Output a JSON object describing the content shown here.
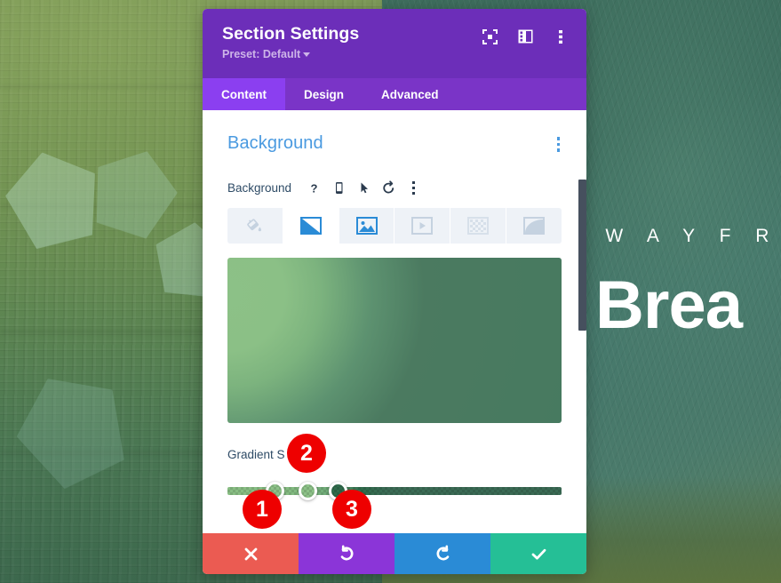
{
  "page_background": {
    "hero_kicker": "E  A W A Y   F R O M",
    "hero_title": "& Brea",
    "note": "website preview behind the settings modal"
  },
  "modal": {
    "title": "Section Settings",
    "preset_label": "Preset: Default",
    "header_icons": [
      {
        "name": "expand-focus-icon",
        "label": "Focus"
      },
      {
        "name": "layout-panel-icon",
        "label": "Panel layout"
      },
      {
        "name": "more-options-icon",
        "label": "More options"
      }
    ],
    "tabs": [
      {
        "label": "Content",
        "active": true
      },
      {
        "label": "Design",
        "active": false
      },
      {
        "label": "Advanced",
        "active": false
      }
    ],
    "section": {
      "title": "Background",
      "options_icon": "more-options-icon"
    },
    "control_row": {
      "label": "Background",
      "buttons": [
        {
          "name": "help-icon",
          "glyph": "?"
        },
        {
          "name": "responsive-mobile-icon",
          "glyph": "mobile"
        },
        {
          "name": "hover-cursor-icon",
          "glyph": "cursor"
        },
        {
          "name": "reset-icon",
          "glyph": "undo-arrow"
        },
        {
          "name": "more-options-icon",
          "glyph": "ellipsis"
        }
      ]
    },
    "background_types": [
      {
        "name": "background-color",
        "label": "Background Color",
        "active": false
      },
      {
        "name": "background-gradient",
        "label": "Background Gradient",
        "active": true
      },
      {
        "name": "background-image",
        "label": "Background Image",
        "active": false
      },
      {
        "name": "background-video",
        "label": "Background Video",
        "active": false
      },
      {
        "name": "background-pattern",
        "label": "Background Pattern",
        "active": false
      },
      {
        "name": "background-mask",
        "label": "Background Mask",
        "active": false
      }
    ],
    "gradient_preview": {
      "type": "radial",
      "colors": [
        "#8cc187",
        "#477a60"
      ]
    },
    "gradient_stops": {
      "label": "Gradient S",
      "full_label_hint": "Gradient Stops",
      "stops": [
        {
          "position_pct": 14,
          "color": "#8cc187"
        },
        {
          "position_pct": 24,
          "color": "#8cc187"
        },
        {
          "position_pct": 33,
          "color": "#2f6b4b"
        }
      ]
    },
    "footer_buttons": [
      {
        "name": "cancel-button",
        "icon": "close-x-icon",
        "color": "#eb5b52"
      },
      {
        "name": "undo-button",
        "icon": "undo-arrow-icon",
        "color": "#8b35d8"
      },
      {
        "name": "redo-button",
        "icon": "redo-arrow-icon",
        "color": "#2a8bd6"
      },
      {
        "name": "save-button",
        "icon": "checkmark-icon",
        "color": "#25bf96"
      }
    ]
  },
  "callouts": [
    {
      "number": "1",
      "target": "first gradient stop handle"
    },
    {
      "number": "2",
      "target": "second gradient stop handle"
    },
    {
      "number": "3",
      "target": "third gradient stop handle"
    }
  ],
  "colors": {
    "header_purple": "#6c2eb9",
    "tab_bar_purple": "#7a34c7",
    "tab_active_purple": "#8b3ff0",
    "section_blue": "#4a9ae0",
    "badge_red": "#ee0000"
  }
}
